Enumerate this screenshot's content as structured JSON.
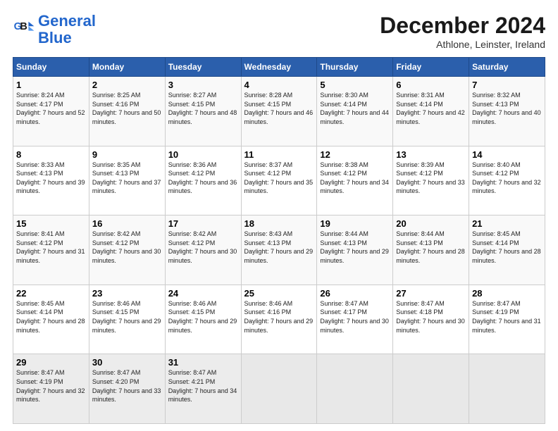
{
  "logo": {
    "line1": "General",
    "line2": "Blue"
  },
  "header": {
    "month": "December 2024",
    "location": "Athlone, Leinster, Ireland"
  },
  "weekdays": [
    "Sunday",
    "Monday",
    "Tuesday",
    "Wednesday",
    "Thursday",
    "Friday",
    "Saturday"
  ],
  "weeks": [
    [
      {
        "day": "1",
        "sunrise": "Sunrise: 8:24 AM",
        "sunset": "Sunset: 4:17 PM",
        "daylight": "Daylight: 7 hours and 52 minutes."
      },
      {
        "day": "2",
        "sunrise": "Sunrise: 8:25 AM",
        "sunset": "Sunset: 4:16 PM",
        "daylight": "Daylight: 7 hours and 50 minutes."
      },
      {
        "day": "3",
        "sunrise": "Sunrise: 8:27 AM",
        "sunset": "Sunset: 4:15 PM",
        "daylight": "Daylight: 7 hours and 48 minutes."
      },
      {
        "day": "4",
        "sunrise": "Sunrise: 8:28 AM",
        "sunset": "Sunset: 4:15 PM",
        "daylight": "Daylight: 7 hours and 46 minutes."
      },
      {
        "day": "5",
        "sunrise": "Sunrise: 8:30 AM",
        "sunset": "Sunset: 4:14 PM",
        "daylight": "Daylight: 7 hours and 44 minutes."
      },
      {
        "day": "6",
        "sunrise": "Sunrise: 8:31 AM",
        "sunset": "Sunset: 4:14 PM",
        "daylight": "Daylight: 7 hours and 42 minutes."
      },
      {
        "day": "7",
        "sunrise": "Sunrise: 8:32 AM",
        "sunset": "Sunset: 4:13 PM",
        "daylight": "Daylight: 7 hours and 40 minutes."
      }
    ],
    [
      {
        "day": "8",
        "sunrise": "Sunrise: 8:33 AM",
        "sunset": "Sunset: 4:13 PM",
        "daylight": "Daylight: 7 hours and 39 minutes."
      },
      {
        "day": "9",
        "sunrise": "Sunrise: 8:35 AM",
        "sunset": "Sunset: 4:13 PM",
        "daylight": "Daylight: 7 hours and 37 minutes."
      },
      {
        "day": "10",
        "sunrise": "Sunrise: 8:36 AM",
        "sunset": "Sunset: 4:12 PM",
        "daylight": "Daylight: 7 hours and 36 minutes."
      },
      {
        "day": "11",
        "sunrise": "Sunrise: 8:37 AM",
        "sunset": "Sunset: 4:12 PM",
        "daylight": "Daylight: 7 hours and 35 minutes."
      },
      {
        "day": "12",
        "sunrise": "Sunrise: 8:38 AM",
        "sunset": "Sunset: 4:12 PM",
        "daylight": "Daylight: 7 hours and 34 minutes."
      },
      {
        "day": "13",
        "sunrise": "Sunrise: 8:39 AM",
        "sunset": "Sunset: 4:12 PM",
        "daylight": "Daylight: 7 hours and 33 minutes."
      },
      {
        "day": "14",
        "sunrise": "Sunrise: 8:40 AM",
        "sunset": "Sunset: 4:12 PM",
        "daylight": "Daylight: 7 hours and 32 minutes."
      }
    ],
    [
      {
        "day": "15",
        "sunrise": "Sunrise: 8:41 AM",
        "sunset": "Sunset: 4:12 PM",
        "daylight": "Daylight: 7 hours and 31 minutes."
      },
      {
        "day": "16",
        "sunrise": "Sunrise: 8:42 AM",
        "sunset": "Sunset: 4:12 PM",
        "daylight": "Daylight: 7 hours and 30 minutes."
      },
      {
        "day": "17",
        "sunrise": "Sunrise: 8:42 AM",
        "sunset": "Sunset: 4:12 PM",
        "daylight": "Daylight: 7 hours and 30 minutes."
      },
      {
        "day": "18",
        "sunrise": "Sunrise: 8:43 AM",
        "sunset": "Sunset: 4:13 PM",
        "daylight": "Daylight: 7 hours and 29 minutes."
      },
      {
        "day": "19",
        "sunrise": "Sunrise: 8:44 AM",
        "sunset": "Sunset: 4:13 PM",
        "daylight": "Daylight: 7 hours and 29 minutes."
      },
      {
        "day": "20",
        "sunrise": "Sunrise: 8:44 AM",
        "sunset": "Sunset: 4:13 PM",
        "daylight": "Daylight: 7 hours and 28 minutes."
      },
      {
        "day": "21",
        "sunrise": "Sunrise: 8:45 AM",
        "sunset": "Sunset: 4:14 PM",
        "daylight": "Daylight: 7 hours and 28 minutes."
      }
    ],
    [
      {
        "day": "22",
        "sunrise": "Sunrise: 8:45 AM",
        "sunset": "Sunset: 4:14 PM",
        "daylight": "Daylight: 7 hours and 28 minutes."
      },
      {
        "day": "23",
        "sunrise": "Sunrise: 8:46 AM",
        "sunset": "Sunset: 4:15 PM",
        "daylight": "Daylight: 7 hours and 29 minutes."
      },
      {
        "day": "24",
        "sunrise": "Sunrise: 8:46 AM",
        "sunset": "Sunset: 4:15 PM",
        "daylight": "Daylight: 7 hours and 29 minutes."
      },
      {
        "day": "25",
        "sunrise": "Sunrise: 8:46 AM",
        "sunset": "Sunset: 4:16 PM",
        "daylight": "Daylight: 7 hours and 29 minutes."
      },
      {
        "day": "26",
        "sunrise": "Sunrise: 8:47 AM",
        "sunset": "Sunset: 4:17 PM",
        "daylight": "Daylight: 7 hours and 30 minutes."
      },
      {
        "day": "27",
        "sunrise": "Sunrise: 8:47 AM",
        "sunset": "Sunset: 4:18 PM",
        "daylight": "Daylight: 7 hours and 30 minutes."
      },
      {
        "day": "28",
        "sunrise": "Sunrise: 8:47 AM",
        "sunset": "Sunset: 4:19 PM",
        "daylight": "Daylight: 7 hours and 31 minutes."
      }
    ],
    [
      {
        "day": "29",
        "sunrise": "Sunrise: 8:47 AM",
        "sunset": "Sunset: 4:19 PM",
        "daylight": "Daylight: 7 hours and 32 minutes."
      },
      {
        "day": "30",
        "sunrise": "Sunrise: 8:47 AM",
        "sunset": "Sunset: 4:20 PM",
        "daylight": "Daylight: 7 hours and 33 minutes."
      },
      {
        "day": "31",
        "sunrise": "Sunrise: 8:47 AM",
        "sunset": "Sunset: 4:21 PM",
        "daylight": "Daylight: 7 hours and 34 minutes."
      },
      null,
      null,
      null,
      null
    ]
  ]
}
